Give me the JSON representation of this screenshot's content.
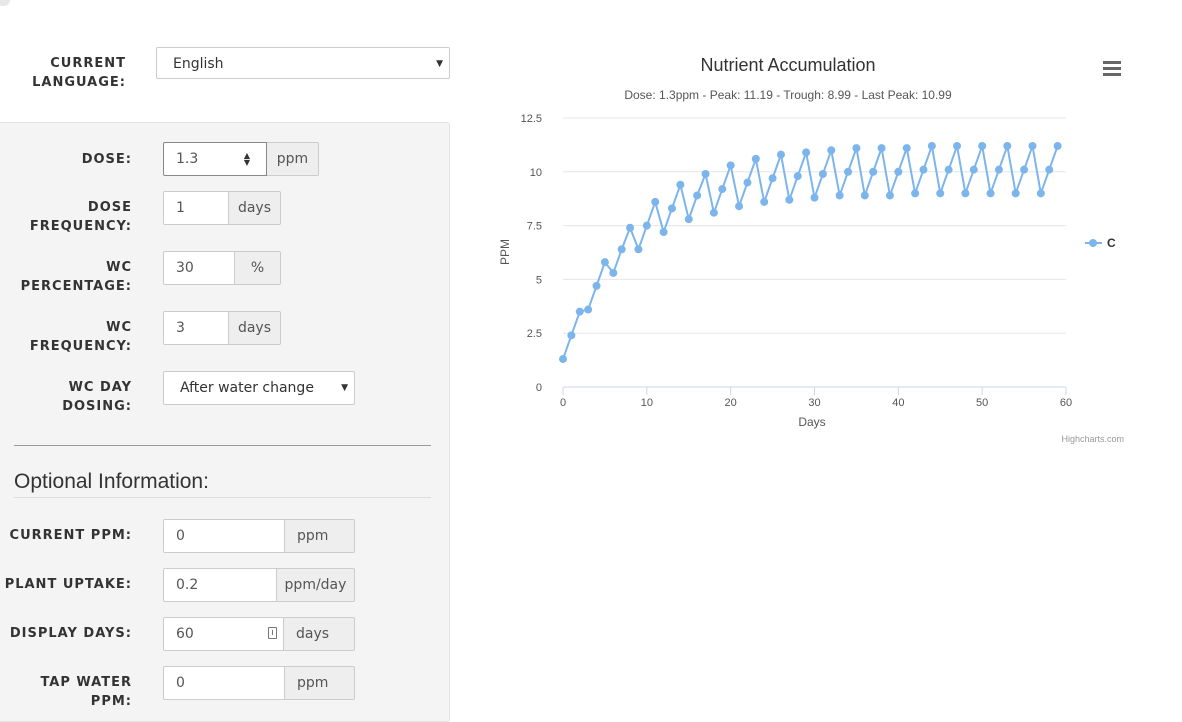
{
  "language": {
    "label_line1": "CURRENT",
    "label_line2": "LANGUAGE:",
    "value": "English"
  },
  "dose": {
    "label": "DOSE:",
    "value": "1.3",
    "unit": "ppm"
  },
  "dose_frequency": {
    "label_line1": "DOSE",
    "label_line2": "FREQUENCY:",
    "value": "1",
    "unit": "days"
  },
  "wc_percentage": {
    "label_line1": "WC",
    "label_line2": "PERCENTAGE:",
    "value": "30",
    "unit": "%"
  },
  "wc_frequency": {
    "label_line1": "WC",
    "label_line2": "FREQUENCY:",
    "value": "3",
    "unit": "days"
  },
  "wc_day_dosing": {
    "label_line1": "WC DAY",
    "label_line2": "DOSING:",
    "value": "After water change"
  },
  "optional": {
    "title": "Optional Information:",
    "current_ppm": {
      "label": "CURRENT PPM:",
      "value": "0",
      "unit": "ppm"
    },
    "plant_uptake": {
      "label": "PLANT UPTAKE:",
      "value": "0.2",
      "unit": "ppm/day"
    },
    "display_days": {
      "label": "DISPLAY DAYS:",
      "value": "60",
      "unit": "days"
    },
    "tap_water": {
      "label_line1": "TAP WATER",
      "label_line2": "PPM:",
      "value": "0",
      "unit": "ppm"
    }
  },
  "chart_data": {
    "type": "line",
    "title": "Nutrient Accumulation",
    "subtitle": "Dose: 1.3ppm - Peak: 11.19 - Trough: 8.99 - Last Peak: 10.99",
    "xlabel": "Days",
    "ylabel": "PPM",
    "xlim": [
      0,
      60
    ],
    "ylim": [
      0,
      12.5
    ],
    "x_ticks": [
      0,
      10,
      20,
      30,
      40,
      50,
      60
    ],
    "y_ticks": [
      0,
      2.5,
      5,
      7.5,
      10,
      12.5
    ],
    "y_tick_labels": [
      "0",
      "2.5",
      "5",
      "7.5",
      "10",
      "12.5"
    ],
    "grid": true,
    "legend_position": "right",
    "credits": "Highcharts.com",
    "series": [
      {
        "name": "C",
        "color": "#7cb5ec",
        "x": [
          0,
          1,
          2,
          3,
          4,
          5,
          6,
          7,
          8,
          9,
          10,
          11,
          12,
          13,
          14,
          15,
          16,
          17,
          18,
          19,
          20,
          21,
          22,
          23,
          24,
          25,
          26,
          27,
          28,
          29,
          30,
          31,
          32,
          33,
          34,
          35,
          36,
          37,
          38,
          39,
          40,
          41,
          42,
          43,
          44,
          45,
          46,
          47,
          48,
          49,
          50,
          51,
          52,
          53,
          54,
          55,
          56,
          57,
          58,
          59
        ],
        "values": [
          1.3,
          2.4,
          3.5,
          3.6,
          4.7,
          5.8,
          5.3,
          6.4,
          7.4,
          6.4,
          7.5,
          8.6,
          7.2,
          8.3,
          9.4,
          7.8,
          8.9,
          9.9,
          8.1,
          9.2,
          10.3,
          8.4,
          9.5,
          10.6,
          8.6,
          9.7,
          10.8,
          8.7,
          9.8,
          10.9,
          8.8,
          9.9,
          11.0,
          8.9,
          10.0,
          11.1,
          8.9,
          10.0,
          11.1,
          8.9,
          10.0,
          11.1,
          9.0,
          10.1,
          11.2,
          9.0,
          10.1,
          11.2,
          9.0,
          10.1,
          11.2,
          9.0,
          10.1,
          11.2,
          9.0,
          10.1,
          11.2,
          9.0,
          10.1,
          11.2
        ]
      }
    ]
  },
  "colors": {
    "series": "#7cb5ec",
    "panel_bg": "#f4f4f4",
    "addon_bg": "#eeeeee"
  },
  "icons": {
    "menu": "hamburger-icon",
    "date": "calendar-icon",
    "spinner": "spinner-icon",
    "dropdown": "chevron-down-icon"
  }
}
